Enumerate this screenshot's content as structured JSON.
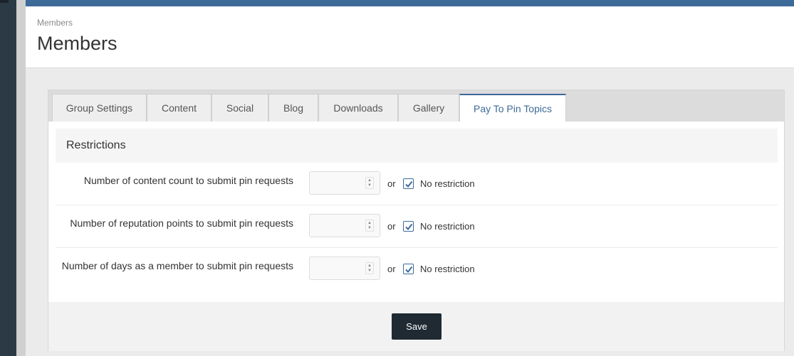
{
  "header": {
    "breadcrumb": "Members",
    "title": "Members"
  },
  "tabs": [
    {
      "label": "Group Settings",
      "active": false
    },
    {
      "label": "Content",
      "active": false
    },
    {
      "label": "Social",
      "active": false
    },
    {
      "label": "Blog",
      "active": false
    },
    {
      "label": "Downloads",
      "active": false
    },
    {
      "label": "Gallery",
      "active": false
    },
    {
      "label": "Pay To Pin Topics",
      "active": true
    }
  ],
  "section": {
    "title": "Restrictions"
  },
  "rows": [
    {
      "label": "Number of content count to submit pin requests",
      "value": "",
      "or_text": "or",
      "checkbox_label": "No restriction",
      "checked": true
    },
    {
      "label": "Number of reputation points to submit pin requests",
      "value": "",
      "or_text": "or",
      "checkbox_label": "No restriction",
      "checked": true
    },
    {
      "label": "Number of days as a member to submit pin requests",
      "value": "",
      "or_text": "or",
      "checkbox_label": "No restriction",
      "checked": true
    }
  ],
  "footer": {
    "save_label": "Save"
  },
  "colors": {
    "accent": "#3d6a98",
    "sidebar": "#2c3a46",
    "button": "#1f2a33"
  }
}
